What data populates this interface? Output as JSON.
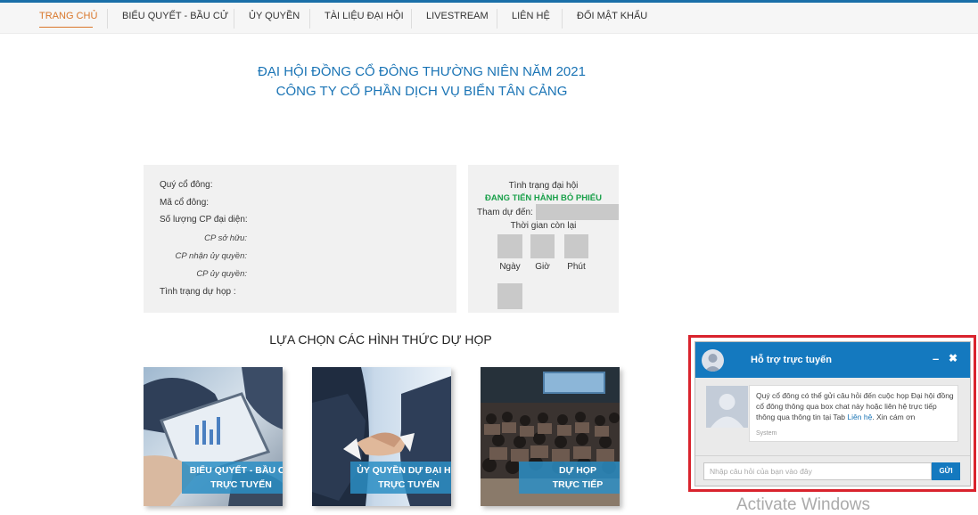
{
  "nav": {
    "items": [
      {
        "label": "TRANG CHỦ",
        "active": true
      },
      {
        "label": "BIỂU QUYẾT - BẦU CỬ"
      },
      {
        "label": "ỦY QUYỀN"
      },
      {
        "label": "TÀI LIỆU ĐẠI HỘI"
      },
      {
        "label": "LIVESTREAM"
      },
      {
        "label": "LIÊN HỆ"
      },
      {
        "label": "ĐỔI MẬT KHẨU"
      }
    ]
  },
  "header": {
    "line1": "ĐẠI HỘI ĐỒNG CỔ ĐÔNG THƯỜNG NIÊN NĂM 2021",
    "line2": "CÔNG TY CỔ PHẦN DỊCH VỤ BIỂN TÂN CẢNG"
  },
  "shareholder": {
    "name_label": "Quý cổ đông:",
    "code_label": "Mã cổ đông:",
    "shares_label": "Số lượng CP đại diện:",
    "owned_label": "CP sở hữu:",
    "received_label": "CP nhận ủy quyền:",
    "delegated_label": "CP ủy quyền:",
    "attendance_label": "Tình trạng dự họp :"
  },
  "status": {
    "title": "Tình trạng đại hội",
    "state": "ĐANG TIẾN HÀNH BỎ PHIẾU",
    "until_label": "Tham dự đến:",
    "remaining_label": "Thời gian còn lại",
    "day_label": "Ngày",
    "hour_label": "Giờ",
    "minute_label": "Phút"
  },
  "choices": {
    "title": "LỰA CHỌN CÁC HÌNH THỨC DỰ HỌP",
    "cards": [
      {
        "line1": "BIỂU QUYẾT - BẦU CỬ",
        "line2": "TRỰC TUYẾN"
      },
      {
        "line1": "ỦY QUYỀN DỰ ĐẠI HỘI",
        "line2": "TRỰC TUYẾN"
      },
      {
        "line1": "DỰ HỌP",
        "line2": "TRỰC TIẾP"
      }
    ]
  },
  "chat": {
    "title": "Hỗ trợ trực tuyến",
    "minimize": "–",
    "close": "✖",
    "message_before": "Quý cổ đông có thể gửi câu hỏi đến cuộc họp Đại hội đồng cổ đông thông qua box chat này hoặc liên hệ trực tiếp thông qua thông tin tại Tab",
    "message_link": "Liên hệ",
    "message_after": ". Xin cám ơn",
    "sender": "System",
    "input_placeholder": "Nhập câu hỏi của bạn vào đây",
    "send_label": "GỬI"
  },
  "watermark": "Activate Windows",
  "colors": {
    "accent": "#1a74b5",
    "nav_active": "#d9772b",
    "status_green": "#1aa04a",
    "highlight_border": "#d9232d"
  }
}
